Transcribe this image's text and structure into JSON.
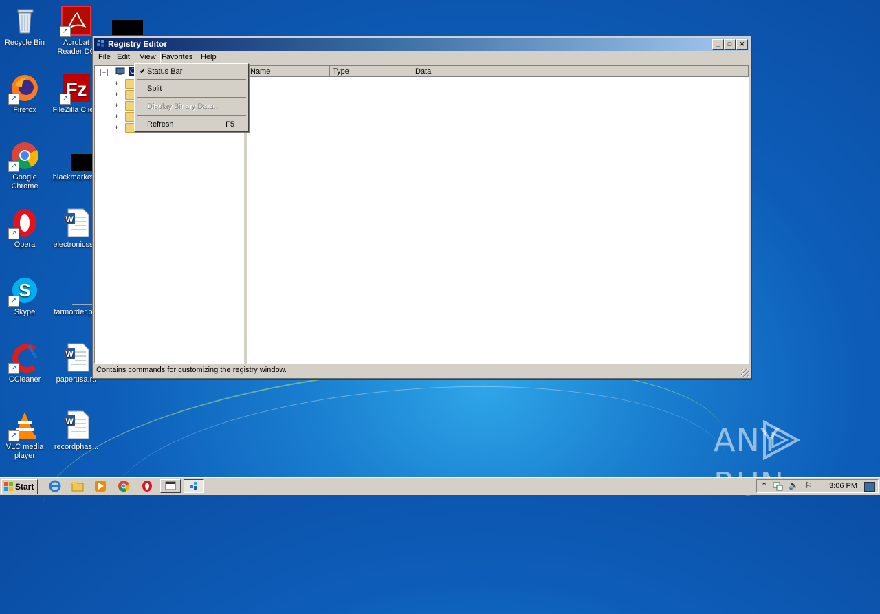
{
  "desktop": {
    "icons": [
      {
        "label": "Recycle Bin"
      },
      {
        "label": "Acrobat Reader DC"
      },
      {
        "label": "Firefox"
      },
      {
        "label": "FileZilla Clie..."
      },
      {
        "label": "Google Chrome"
      },
      {
        "label": "blackmarket..."
      },
      {
        "label": "Opera"
      },
      {
        "label": "electronicss..."
      },
      {
        "label": "Skype"
      },
      {
        "label": "farmorder.p..."
      },
      {
        "label": "CCleaner"
      },
      {
        "label": "paperusa.rtf"
      },
      {
        "label": "VLC media player"
      },
      {
        "label": "recordphas..."
      }
    ]
  },
  "window": {
    "title": "Registry Editor",
    "controls": {
      "minimize": "_",
      "maximize": "□",
      "close": "✕"
    },
    "menu": [
      "File",
      "Edit",
      "View",
      "Favorites",
      "Help"
    ],
    "tree_root_label": "Co",
    "columns": [
      "Name",
      "Type",
      "Data"
    ],
    "status": "Contains commands for customizing the registry window."
  },
  "view_menu": {
    "items": [
      {
        "label": "Status Bar",
        "checked": true,
        "check_mark": "✔"
      },
      {
        "label": "Split"
      },
      {
        "label": "Display Binary Data...",
        "disabled": true
      },
      {
        "label": "Refresh",
        "shortcut": "F5"
      }
    ]
  },
  "taskbar": {
    "start_label": "Start",
    "clock": "3:06 PM"
  },
  "watermark": {
    "text_left": "ANY",
    "text_right": "RUN"
  },
  "colors": {
    "titlebar_start": "#0a246a",
    "titlebar_end": "#a6caf0",
    "selection": "#0a246a"
  }
}
